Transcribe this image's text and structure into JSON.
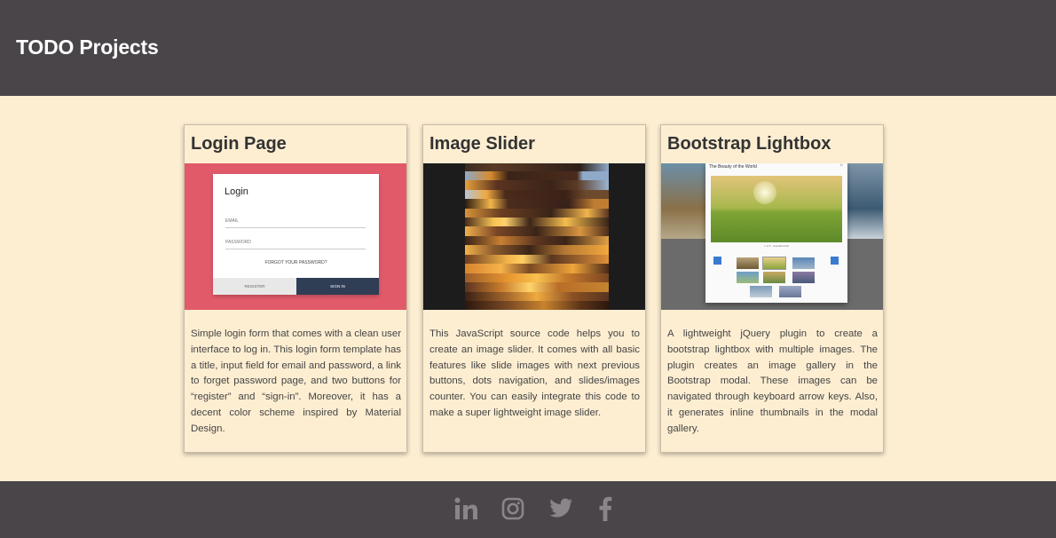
{
  "header": {
    "title": "TODO Projects"
  },
  "cards": [
    {
      "title": "Login Page",
      "image": {
        "login_title": "Login",
        "email_label": "EMAIL",
        "password_label": "PASSWORD",
        "forgot_label": "FORGOT YOUR PASSWORD?",
        "register_label": "REGISTER",
        "signin_label": "SIGN IN"
      },
      "description": "Simple login form that comes with a clean user interface to log in. This login form template has a title, input field for email and password, a link to forget password page, and two buttons for “register” and “sign-in”. Moreover, it has a decent color scheme inspired by Material Design."
    },
    {
      "title": "Image Slider",
      "description": "This JavaScript source code helps you to create an image slider. It comes with all basic features like slide images with next previous buttons, dots navigation, and slides/images counter. You can easily integrate this code to make a super lightweight image slider."
    },
    {
      "title": "Bootstrap Lightbox",
      "image": {
        "modal_title": "The Beauty of the World",
        "close_glyph": "×",
        "caption": "1 of 6 · beautiful field"
      },
      "description": "A lightweight jQuery plugin to create a bootstrap lightbox with multiple images. The plugin creates an image gallery in the Bootstrap modal. These images can be navigated through keyboard arrow keys. Also, it generates inline thumbnails in the modal gallery."
    }
  ],
  "footer": {
    "icons": [
      "linkedin-icon",
      "instagram-icon",
      "twitter-icon",
      "facebook-icon"
    ]
  },
  "colors": {
    "header_bg": "#4a4549",
    "page_bg": "#fdeed2",
    "login_accent": "#e05a6a",
    "signin_button": "#2f3d55",
    "footer_icon": "#8a8588"
  }
}
